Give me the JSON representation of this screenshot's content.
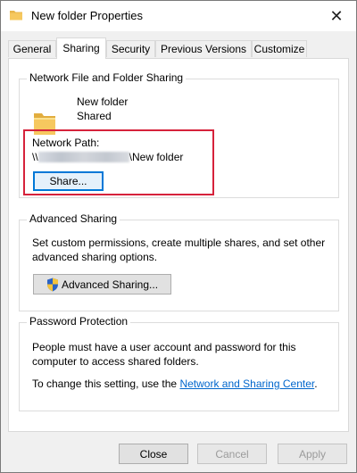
{
  "window": {
    "title": "New folder Properties",
    "title_icon": "folder-icon",
    "close_glyph": "✕"
  },
  "tabs": [
    {
      "label": "General",
      "active": false
    },
    {
      "label": "Sharing",
      "active": true
    },
    {
      "label": "Security",
      "active": false
    },
    {
      "label": "Previous Versions",
      "active": false
    },
    {
      "label": "Customize",
      "active": false
    }
  ],
  "network_sharing": {
    "group_title": "Network File and Folder Sharing",
    "folder_icon": "folder-icon",
    "folder_name": "New folder",
    "folder_status": "Shared",
    "network_path_label": "Network Path:",
    "network_path_prefix": "\\\\",
    "network_path_suffix": "\\New folder",
    "share_button": "Share..."
  },
  "advanced_sharing": {
    "group_title": "Advanced Sharing",
    "description": "Set custom permissions, create multiple shares, and set other advanced sharing options.",
    "shield_icon": "uac-shield-icon",
    "button": "Advanced Sharing..."
  },
  "password_protection": {
    "group_title": "Password Protection",
    "description": "People must have a user account and password for this computer to access shared folders.",
    "change_text": "To change this setting, use the ",
    "link_text": "Network and Sharing Center",
    "after_link": "."
  },
  "footer": {
    "close": "Close",
    "cancel": "Cancel",
    "apply": "Apply"
  },
  "colors": {
    "highlight": "#d6223b",
    "link": "#0066cc",
    "folder": "#f6c85f"
  }
}
